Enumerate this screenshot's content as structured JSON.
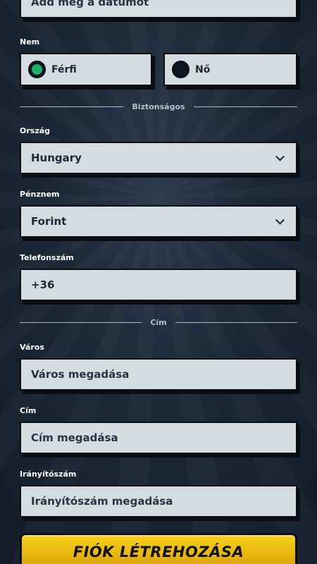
{
  "birthdate": {
    "placeholder": "Add meg a dátumot"
  },
  "gender": {
    "label": "Nem",
    "options": [
      {
        "label": "Férfi",
        "selected": true
      },
      {
        "label": "Nő",
        "selected": false
      }
    ],
    "selected_color": "#19b36b"
  },
  "dividers": {
    "security": "Biztonságos",
    "address": "Cím"
  },
  "country": {
    "label": "Ország",
    "value": "Hungary"
  },
  "currency": {
    "label": "Pénznem",
    "value": "Forint"
  },
  "phone": {
    "label": "Telefonszám",
    "value": "+36"
  },
  "city": {
    "label": "Város",
    "placeholder": "Város megadása"
  },
  "address": {
    "label": "Cím",
    "placeholder": "Cím megadása"
  },
  "zip": {
    "label": "Irányítószám",
    "placeholder": "Irányítószám megadása"
  },
  "submit": {
    "label": "FIÓK LÉTREHOZÁSA",
    "color": "#f4d21c"
  }
}
